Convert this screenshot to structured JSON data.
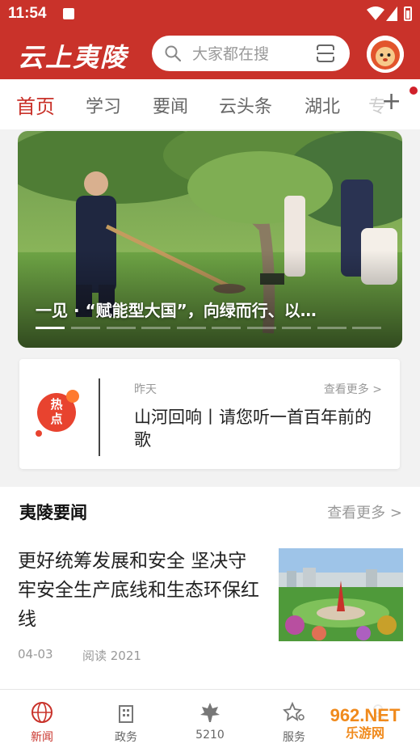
{
  "status": {
    "time": "11:54"
  },
  "header": {
    "logo": "云上夷陵",
    "search_placeholder": "大家都在搜"
  },
  "tabs": [
    "首页",
    "学习",
    "要闻",
    "云头条",
    "湖北",
    "专"
  ],
  "banner": {
    "title": "一见 · “赋能型大国”，向绿而行、以…",
    "slide_count": 10,
    "active_slide": 1
  },
  "hot": {
    "badge": "热点",
    "date": "昨天",
    "more": "查看更多 >",
    "headline": "山河回响丨请您听一首百年前的歌"
  },
  "news": {
    "section_title": "夷陵要闻",
    "more": "查看更多 >",
    "article": {
      "title": "更好统筹发展和安全 坚决守牢安全生产底线和生态环保红线",
      "date": "04-03",
      "reads": "阅读 2021"
    }
  },
  "bottom_nav": [
    {
      "label": "新闻",
      "icon": "globe-icon",
      "active": true
    },
    {
      "label": "政务",
      "icon": "building-icon",
      "active": false
    },
    {
      "label": "5210",
      "icon": "maple-leaf-icon",
      "active": false
    },
    {
      "label": "服务",
      "icon": "star-service-icon",
      "active": false
    },
    {
      "label": "",
      "icon": "profile-icon",
      "active": false
    }
  ],
  "watermark": "962.NET 乐游网",
  "colors": {
    "brand": "#c9322a",
    "accent": "#e8432f"
  }
}
